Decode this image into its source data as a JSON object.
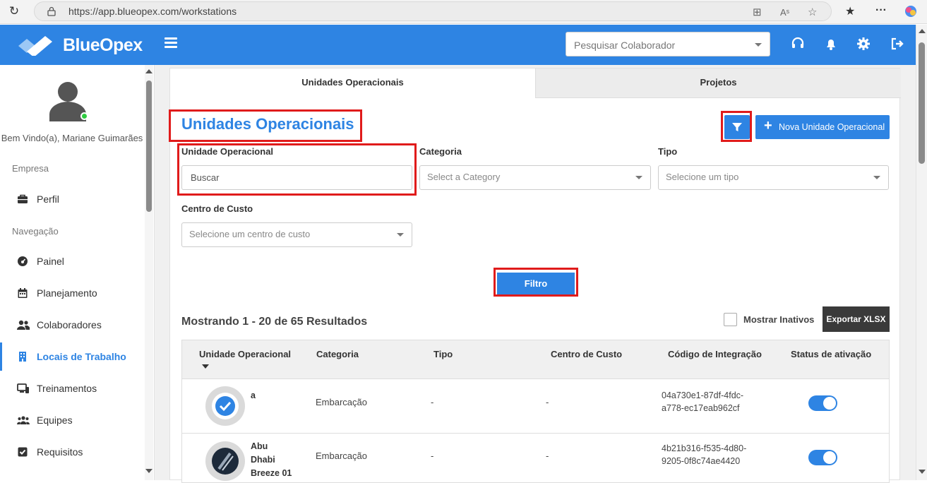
{
  "browser": {
    "url": "https://app.blueopex.com/workstations"
  },
  "header": {
    "brand": "BlueOpex",
    "search_placeholder": "Pesquisar Colaborador",
    "accent_color": "#2e84e3"
  },
  "sidebar": {
    "welcome": "Bem Vindo(a), Mariane Guimarães",
    "section_empresa": "Empresa",
    "section_navegacao": "Navegação",
    "items": [
      {
        "label": "Perfil",
        "icon": "briefcase-icon"
      },
      {
        "label": "Painel",
        "icon": "dashboard-icon"
      },
      {
        "label": "Planejamento",
        "icon": "calendar-icon"
      },
      {
        "label": "Colaboradores",
        "icon": "users-icon"
      },
      {
        "label": "Locais de Trabalho",
        "icon": "building-icon",
        "active": true
      },
      {
        "label": "Treinamentos",
        "icon": "devices-icon"
      },
      {
        "label": "Equipes",
        "icon": "team-icon"
      },
      {
        "label": "Requisitos",
        "icon": "checkbox-icon"
      }
    ]
  },
  "tabs": {
    "unidades": "Unidades Operacionais",
    "projetos": "Projetos"
  },
  "page": {
    "title": "Unidades Operacionais",
    "new_button": "Nova Unidade Operacional",
    "filters": {
      "unidade_label": "Unidade Operacional",
      "unidade_value": "Buscar",
      "categoria_label": "Categoria",
      "categoria_placeholder": "Select a Category",
      "tipo_label": "Tipo",
      "tipo_placeholder": "Selecione um tipo",
      "centro_label": "Centro de Custo",
      "centro_placeholder": "Selecione um centro de custo"
    },
    "filter_button": "Filtro",
    "results_text": "Mostrando 1 - 20 de 65 Resultados",
    "show_inactive": "Mostrar Inativos",
    "export_button": "Exportar XLSX"
  },
  "table": {
    "columns": [
      "Unidade Operacional",
      "Categoria",
      "Tipo",
      "Centro de Custo",
      "Código de Integração",
      "Status de ativação"
    ],
    "rows": [
      {
        "name": "a",
        "categoria": "Embarcação",
        "tipo": "-",
        "centro": "-",
        "codigo_1": "04a730e1-87df-4fdc-",
        "codigo_2": "a778-ec17eab962cf",
        "active": true
      },
      {
        "name_1": "Abu",
        "name_2": "Dhabi",
        "name_3": "Breeze 01",
        "categoria": "Embarcação",
        "tipo": "-",
        "centro": "-",
        "codigo_1": "4b21b316-f535-4d80-",
        "codigo_2": "9205-0f8c74ae4420",
        "active": true
      }
    ]
  }
}
